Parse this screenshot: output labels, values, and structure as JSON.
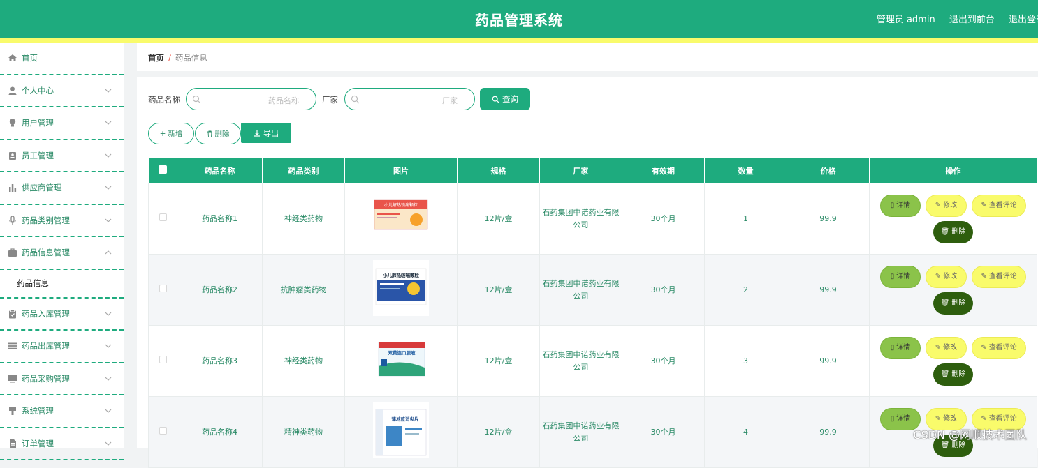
{
  "header": {
    "title": "药品管理系统",
    "admin_label": "管理员 admin",
    "front_link": "退出到前台",
    "logout_link": "退出登录"
  },
  "sidebar": {
    "items": [
      {
        "label": "首页",
        "icon": "home-icon"
      },
      {
        "label": "个人中心",
        "icon": "user-icon"
      },
      {
        "label": "用户管理",
        "icon": "bulb-icon"
      },
      {
        "label": "员工管理",
        "icon": "badge-icon"
      },
      {
        "label": "供应商管理",
        "icon": "bar-chart-icon"
      },
      {
        "label": "药品类别管理",
        "icon": "microphone-icon"
      },
      {
        "label": "药品信息管理",
        "icon": "briefcase-icon",
        "expanded": true
      },
      {
        "label": "药品信息",
        "sub": true
      },
      {
        "label": "药品入库管理",
        "icon": "clipboard-icon"
      },
      {
        "label": "药品出库管理",
        "icon": "list-icon"
      },
      {
        "label": "药品采购管理",
        "icon": "monitor-icon"
      },
      {
        "label": "系统管理",
        "icon": "stamp-icon"
      },
      {
        "label": "订单管理",
        "icon": "document-icon"
      }
    ]
  },
  "breadcrumb": {
    "home": "首页",
    "separator": "/",
    "current": "药品信息"
  },
  "search": {
    "name_label": "药品名称",
    "name_placeholder": "药品名称",
    "maker_label": "厂家",
    "maker_placeholder": "厂家",
    "query_button": "查询"
  },
  "actions": {
    "add": "新增",
    "delete": "删除",
    "export": "导出"
  },
  "table": {
    "headers": [
      "药品名称",
      "药品类别",
      "图片",
      "规格",
      "厂家",
      "有效期",
      "数量",
      "价格",
      "操作"
    ],
    "rows": [
      {
        "name": "药品名称1",
        "category": "神经类药物",
        "spec": "12片/盒",
        "maker": "石药集团中诺药业有限公司",
        "validity": "30个月",
        "qty": "1",
        "price": "99.9",
        "img_text": "小儿解热镇痛颗粒"
      },
      {
        "name": "药品名称2",
        "category": "抗肿瘤类药物",
        "spec": "12片/盒",
        "maker": "石药集团中诺药业有限公司",
        "validity": "30个月",
        "qty": "2",
        "price": "99.9",
        "img_text": "小儿肺热咳喘颗粒"
      },
      {
        "name": "药品名称3",
        "category": "神经类药物",
        "spec": "12片/盒",
        "maker": "石药集团中诺药业有限公司",
        "validity": "30个月",
        "qty": "3",
        "price": "99.9",
        "img_text": "双黄连口服液"
      },
      {
        "name": "药品名称4",
        "category": "精神类药物",
        "spec": "12片/盒",
        "maker": "石药集团中诺药业有限公司",
        "validity": "30个月",
        "qty": "4",
        "price": "99.9",
        "img_text": "蒲地蓝消炎片"
      }
    ],
    "row_ops": {
      "detail": "详情",
      "edit": "修改",
      "review": "查看评论",
      "delete": "删除"
    }
  },
  "watermark": "CSDN @网顺技术团队",
  "colors": {
    "primary": "#1eab7e",
    "accent_yellow": "#f9fb6b",
    "detail_green": "#8bc34a",
    "delete_dark": "#2e5e0e"
  }
}
